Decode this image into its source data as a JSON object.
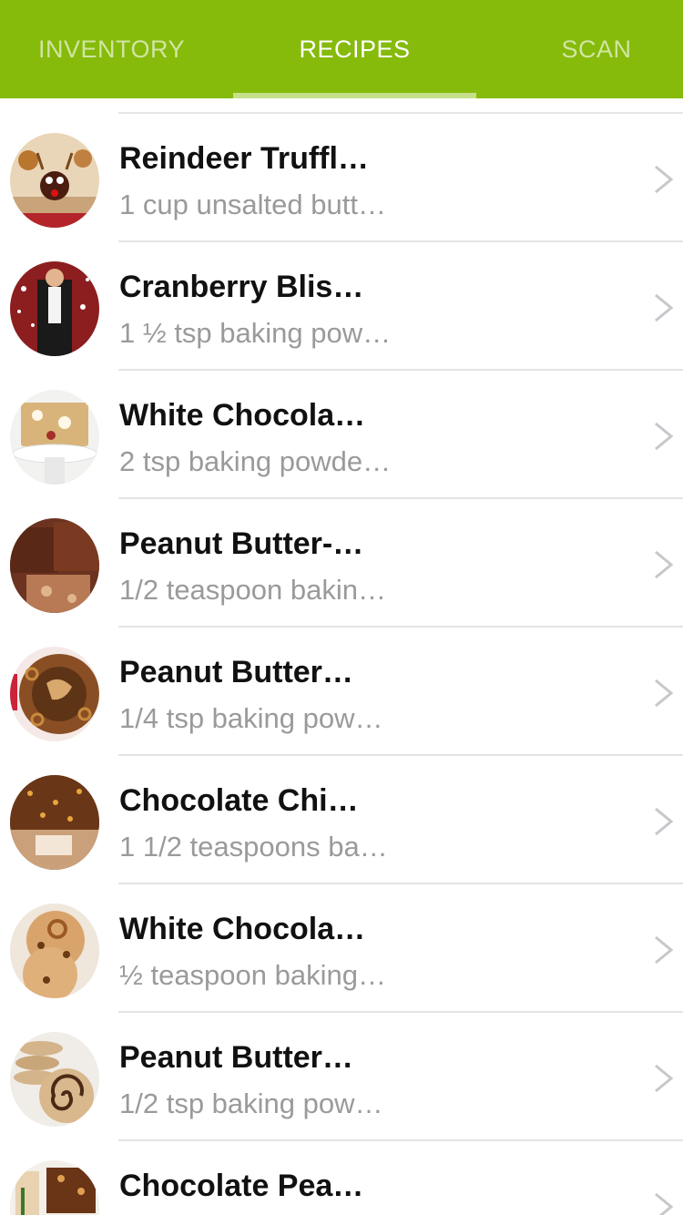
{
  "tabs": [
    {
      "label": "INVENTORY",
      "selected": false
    },
    {
      "label": "RECIPES",
      "selected": true
    },
    {
      "label": "SCAN",
      "selected": false
    }
  ],
  "colors": {
    "accent": "#86ba0b",
    "indicator": "#c6e08a",
    "subtitle": "#9a9a9a",
    "chevron": "#c7c7cc"
  },
  "recipes": [
    {
      "title": "Reindeer Truffl…",
      "subtitle": "1 cup unsalted butt…",
      "image": "reindeer-truffles-photo"
    },
    {
      "title": "Cranberry Blis…",
      "subtitle": "1 ½ tsp baking pow…",
      "image": "cranberry-bliss-photo"
    },
    {
      "title": "White Chocola…",
      "subtitle": "2 tsp baking powde…",
      "image": "white-chocolate-bars-photo"
    },
    {
      "title": "Peanut Butter-…",
      "subtitle": "1/2 teaspoon bakin…",
      "image": "peanut-butter-brownies-photo"
    },
    {
      "title": "Peanut Butter…",
      "subtitle": "1/4 tsp baking pow…",
      "image": "peanut-butter-pretzel-pie-photo"
    },
    {
      "title": "Chocolate Chi…",
      "subtitle": "1 1/2 teaspoons ba…",
      "image": "chocolate-chip-bars-photo"
    },
    {
      "title": "White Chocola…",
      "subtitle": "½ teaspoon baking…",
      "image": "pretzel-cookies-photo"
    },
    {
      "title": "Peanut Butter…",
      "subtitle": "1/2 tsp baking pow…",
      "image": "pinwheel-cookies-photo"
    },
    {
      "title": "Chocolate Pea…",
      "subtitle": "",
      "image": "chocolate-peanut-bars-photo"
    }
  ]
}
